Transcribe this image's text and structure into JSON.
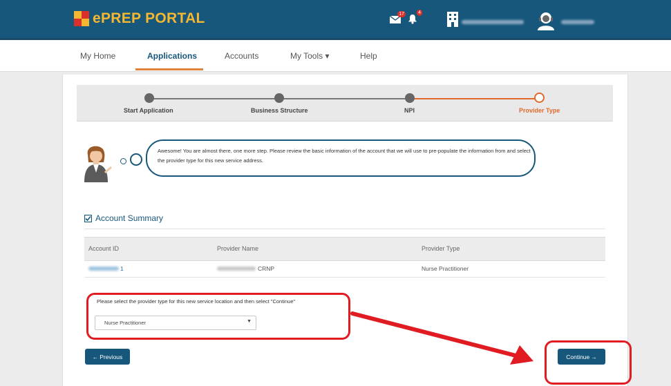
{
  "header": {
    "brand_title": "ePREP PORTAL",
    "mail_badge": "17",
    "bell_badge": "4"
  },
  "nav": {
    "items": [
      {
        "label": "My Home"
      },
      {
        "label": "Applications"
      },
      {
        "label": "Accounts"
      },
      {
        "label": "My Tools ▾"
      },
      {
        "label": "Help"
      }
    ]
  },
  "stepper": {
    "steps": [
      {
        "label": "Start Application"
      },
      {
        "label": "Business Structure"
      },
      {
        "label": "NPI"
      },
      {
        "label": "Provider Type"
      }
    ]
  },
  "assistant": {
    "message": "Awesome! You are almost there, one more step. Please review the basic information of the account that we will use to pre-populate the information from and select the provider type for this new service address."
  },
  "summary": {
    "title": "Account Summary",
    "columns": [
      "Account ID",
      "Provider Name",
      "Provider Type"
    ],
    "row": {
      "account_id_suffix": "1",
      "provider_name_suffix": "CRNP",
      "provider_type": "Nurse Practitioner"
    }
  },
  "form": {
    "select_label": "Please select the provider type for this new service location and then select \"Continue\"",
    "select_value": "Nurse Practitioner"
  },
  "buttons": {
    "previous": "Previous",
    "continue": "Continue"
  },
  "colors": {
    "brand": "#17577c",
    "accent": "#e06a2c",
    "highlight": "#e01b22"
  }
}
